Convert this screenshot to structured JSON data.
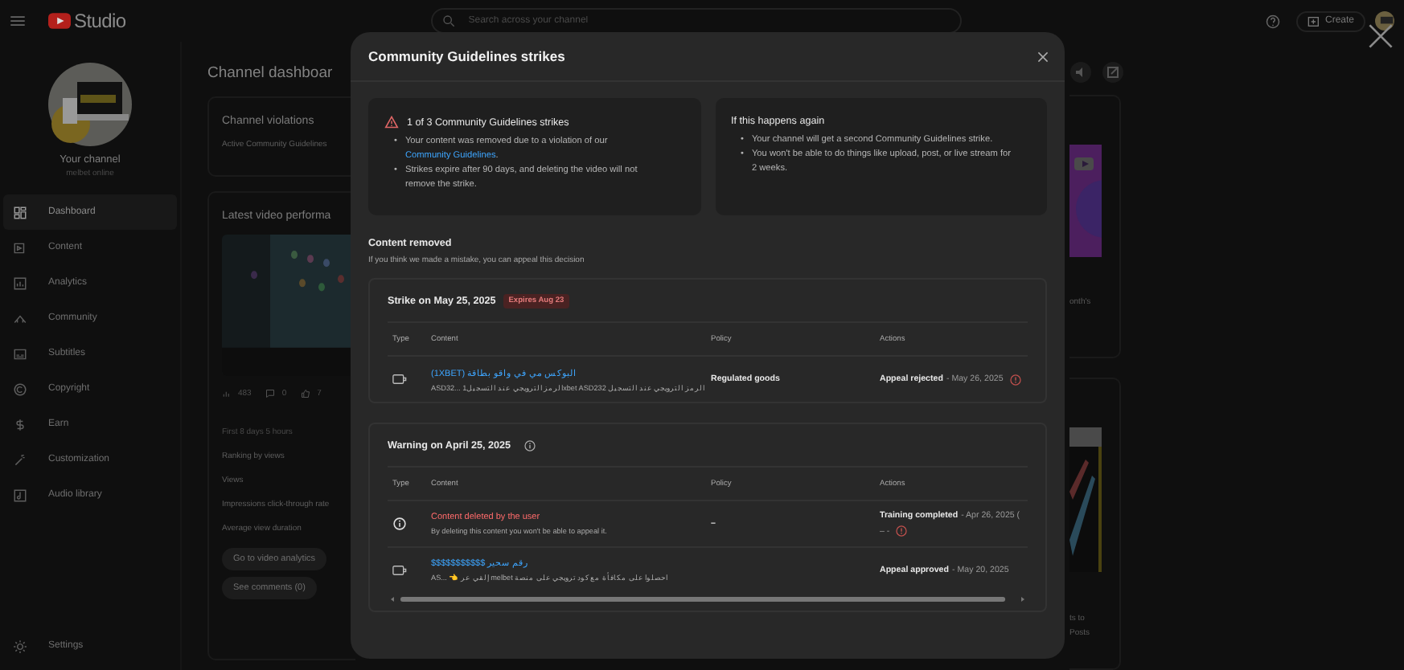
{
  "topbar": {
    "logo": "Studio",
    "search": {
      "placeholder": "Search across your channel"
    },
    "create": "Create"
  },
  "sidebar": {
    "channel_name": "Your channel",
    "channel_handle": "melbet online",
    "items": [
      {
        "label": "Dashboard",
        "selected": true
      },
      {
        "label": "Content",
        "selected": false
      },
      {
        "label": "Analytics",
        "selected": false
      },
      {
        "label": "Community",
        "selected": false
      },
      {
        "label": "Subtitles",
        "selected": false
      },
      {
        "label": "Copyright",
        "selected": false
      },
      {
        "label": "Earn",
        "selected": false
      },
      {
        "label": "Customization",
        "selected": false
      },
      {
        "label": "Audio library",
        "selected": false
      }
    ],
    "bottom_items": [
      {
        "label": "Settings",
        "selected": false
      }
    ]
  },
  "dashboard": {
    "title": "Channel dashboar",
    "violations": {
      "title": "Channel violations",
      "text": "Active Community Guidelines"
    },
    "latest": {
      "title": "Latest video performa",
      "stats": [
        "483",
        "0",
        "7"
      ],
      "period": "First 8 days 5 hours",
      "metrics": [
        "Ranking by views",
        "Views",
        "Impressions click-through rate",
        "Average view duration"
      ],
      "buttons": [
        "Go to video analytics",
        "See comments (0)"
      ]
    },
    "right_text": "onth's",
    "bottom_texts": [
      "ts to",
      "Posts"
    ]
  },
  "modal": {
    "title": "Community Guidelines strikes",
    "panels": [
      {
        "kind": "strike",
        "title": "1 of 3 Community Guidelines strikes",
        "bullets": [
          {
            "marker": "•",
            "text": "Your content was removed due to a violation of our ",
            "link": "Community Guidelines",
            "after": "."
          },
          {
            "marker": "•",
            "text": "Strikes expire after 90 days, and deleting the video will not remove the strike."
          }
        ]
      },
      {
        "kind": "plain",
        "title": "If this happens again",
        "bullets": [
          {
            "marker": "•",
            "text": "Your channel will get a second Community Guidelines strike."
          },
          {
            "marker": "•",
            "text": "You won't be able to do things like upload, post, or live stream for 2 weeks."
          }
        ]
      }
    ],
    "section": {
      "title": "Content removed",
      "subtitle": "If you think we made a mistake, you can appeal this decision"
    },
    "cards": [
      {
        "title": "Strike on May 25, 2025",
        "badge": "Expires Aug 23",
        "info_icon": false,
        "scrollbar": false,
        "columns": [
          "Type",
          "Content",
          "Policy",
          "Actions"
        ],
        "rows": [
          {
            "kind": "video",
            "title": "(1XBET) البوكس مي في واقو بطاقة",
            "description": "ASD32... الرمز الترويجي عند التسجيل1xbet ASD232 الرمز الترويجي عند التسجيل",
            "policy": "Regulated goods",
            "action": "Appeal rejected",
            "action_date": "- May 26, 2025",
            "action_icon": true
          }
        ]
      },
      {
        "title": "Warning on April 25, 2025",
        "info_icon": true,
        "scrollbar": true,
        "columns": [
          "Type",
          "Content",
          "Policy",
          "Actions"
        ],
        "rows": [
          {
            "kind": "deleted",
            "title": "Content deleted by the user",
            "description": "By deleting this content you won't be able to appeal it.",
            "policy": "–",
            "action": "Training completed",
            "action_date": "- Apr 26, 2025 (",
            "action_extra": "– -",
            "action_icon": true
          },
          {
            "kind": "video",
            "title": "$$$$$$$$$$$ رقم سحير",
            "description": "AS... 👈 إلقي عر melbet احصلوا على مكافأة مع كود ترويجي على منصة",
            "action": "Appeal approved",
            "action_date": "- May 20, 2025",
            "action_icon": false
          }
        ]
      }
    ]
  }
}
